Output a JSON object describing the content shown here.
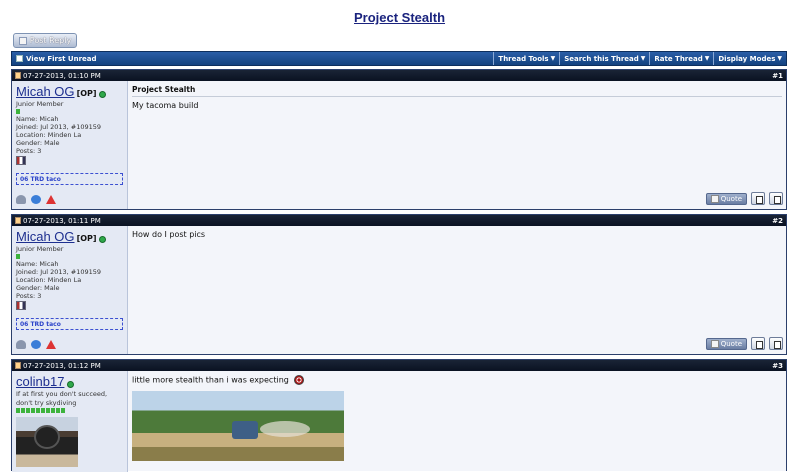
{
  "thread": {
    "title": "Project Stealth",
    "post_reply_label": "Post Reply"
  },
  "toolbar": {
    "view_first_unread": "View First Unread",
    "menus": [
      "Thread Tools",
      "Search this Thread",
      "Rate Thread",
      "Display Modes"
    ]
  },
  "posts": [
    {
      "date": "07-27-2013, 01:10 PM",
      "number": "#1",
      "username": "Micah OG",
      "op_tag": "[OP]",
      "user_title": "Junior Member",
      "name": "Name: Micah",
      "joined": "Joined: Jul 2013, #109159",
      "location": "Location: Minden La",
      "gender": "Gender: Male",
      "posts": "Posts: 3",
      "garage": "06 TRD taco",
      "message_title": "Project Stealth",
      "message": "My tacoma build",
      "quote_label": "Quote"
    },
    {
      "date": "07-27-2013, 01:11 PM",
      "number": "#2",
      "username": "Micah OG",
      "op_tag": "[OP]",
      "user_title": "Junior Member",
      "name": "Name: Micah",
      "joined": "Joined: Jul 2013, #109159",
      "location": "Location: Minden La",
      "gender": "Gender: Male",
      "posts": "Posts: 3",
      "garage": "06 TRD taco",
      "message": "How do I post pics",
      "quote_label": "Quote"
    },
    {
      "date": "07-27-2013, 01:12 PM",
      "number": "#3",
      "username": "colinb17",
      "signature_line1": "If at first you don't succeed,",
      "signature_line2": "don't try skydiving",
      "message": "little more stealth than i was expecting"
    }
  ]
}
